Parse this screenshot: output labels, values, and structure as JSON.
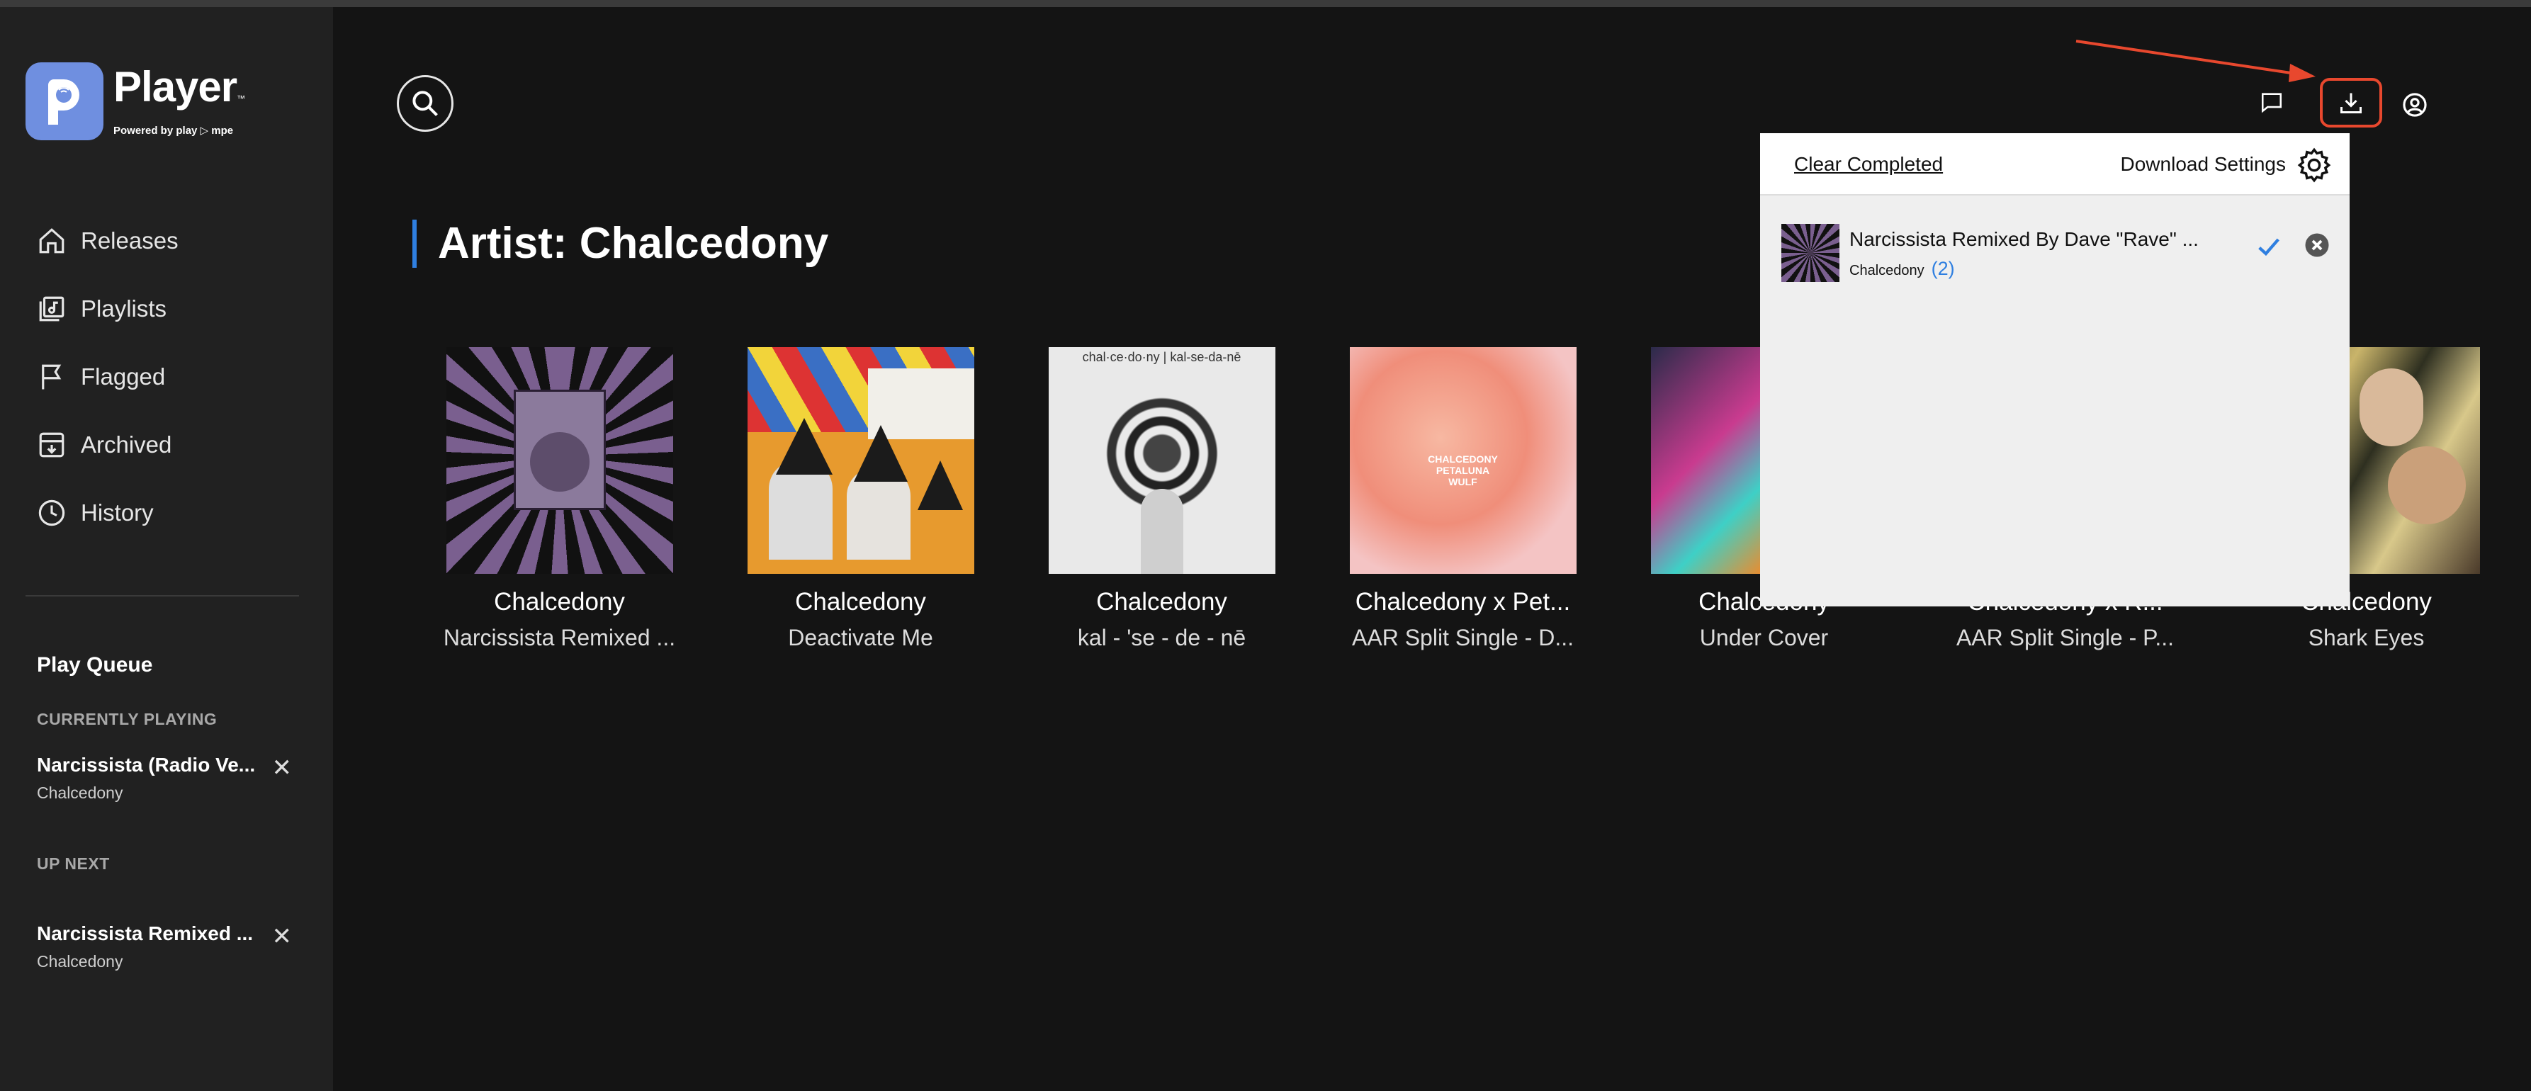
{
  "brand": {
    "title": "Player",
    "tm": "™",
    "subtitle": "Powered by play ▷ mpe"
  },
  "nav": [
    {
      "label": "Releases",
      "icon": "home-icon"
    },
    {
      "label": "Playlists",
      "icon": "playlist-icon"
    },
    {
      "label": "Flagged",
      "icon": "flag-icon"
    },
    {
      "label": "Archived",
      "icon": "archive-icon"
    },
    {
      "label": "History",
      "icon": "clock-icon"
    }
  ],
  "play_queue": {
    "title": "Play Queue",
    "currently_playing_label": "CURRENTLY PLAYING",
    "current": {
      "title": "Narcissista (Radio Ve...",
      "artist": "Chalcedony"
    },
    "up_next_label": "UP NEXT",
    "next": {
      "title": "Narcissista Remixed ...",
      "artist": "Chalcedony"
    }
  },
  "page": {
    "title": "Artist: Chalcedony"
  },
  "albums": [
    {
      "name": "Chalcedony",
      "subtitle": "Narcissista Remixed ..."
    },
    {
      "name": "Chalcedony",
      "subtitle": "Deactivate Me"
    },
    {
      "name": "Chalcedony",
      "subtitle": "kal - 'se - de - nē"
    },
    {
      "name": "Chalcedony x Pet...",
      "subtitle": "AAR Split Single - D..."
    },
    {
      "name": "Chalcedony",
      "subtitle": "Under Cover"
    },
    {
      "name": "Chalcedony x R...",
      "subtitle": "AAR Split Single - P..."
    },
    {
      "name": "Chalcedony",
      "subtitle": "Shark Eyes"
    }
  ],
  "covers": {
    "c3_text": "chal·ce·do·ny | kal-se-da-nē",
    "c4_text": "CHALCEDONY\nPETALUNA\nWULF"
  },
  "downloads_panel": {
    "clear_label": "Clear Completed",
    "settings_label": "Download Settings",
    "items": [
      {
        "title": "Narcissista Remixed By Dave \"Rave\" ...",
        "artist": "Chalcedony",
        "count": "(2)"
      }
    ]
  },
  "colors": {
    "accent": "#2f7fe0",
    "highlight": "#e8482e",
    "sidebar": "#212121",
    "background": "#141414"
  }
}
